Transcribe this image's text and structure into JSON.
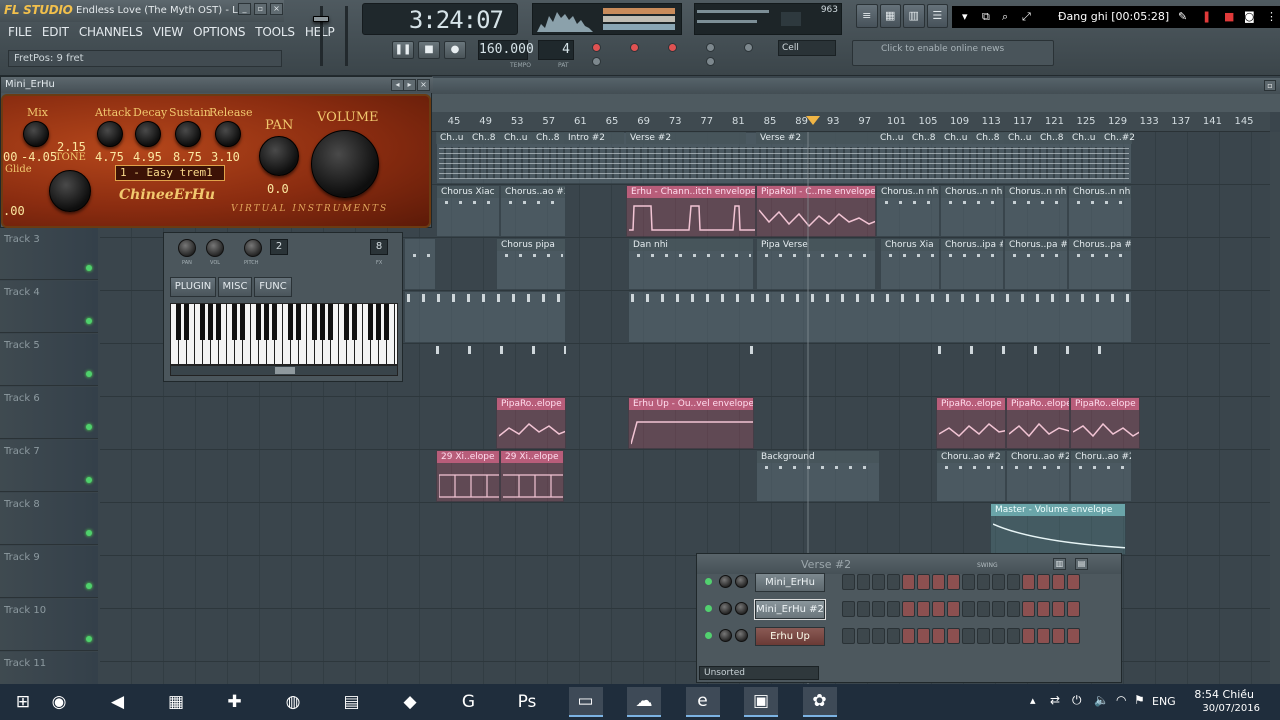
{
  "app": {
    "logo": "FL STUDIO",
    "song_title": "Endless Love (The Myth OST) - L",
    "menu": [
      "FILE",
      "EDIT",
      "CHANNELS",
      "VIEW",
      "OPTIONS",
      "TOOLS",
      "HELP"
    ],
    "hint": "FretPos: 9 fret",
    "time": "3:24:07",
    "tempo": "160.000",
    "pattern": "4",
    "tempo_label": "TEMPO",
    "pat_label": "PAT",
    "cpu_value": "963",
    "snap": "Cell",
    "news": "Click to enable online news"
  },
  "recorder": {
    "label": "Đang ghi [00:05:28]"
  },
  "playlist": {
    "title": "Mini_ErHu",
    "ticks": [
      "45",
      "49",
      "53",
      "57",
      "61",
      "65",
      "69",
      "73",
      "77",
      "81",
      "85",
      "89",
      "93",
      "97",
      "101",
      "105",
      "109",
      "113",
      "117",
      "121",
      "125",
      "129",
      "133",
      "137",
      "141",
      "145"
    ],
    "tracks": [
      "Track 3",
      "Track 4",
      "Track 5",
      "Track 6",
      "Track 7",
      "Track 8",
      "Track 9",
      "Track 10",
      "Track 11"
    ],
    "clips": {
      "t1": [
        "Ch..u",
        "Ch..8",
        "Ch..u",
        "Ch..8",
        "Intro #2",
        "Verse #2",
        "Verse #2",
        "Ch..u",
        "Ch..8",
        "Ch..u",
        "Ch..8",
        "Ch..u",
        "Ch..8",
        "Ch..u",
        "Ch..#2"
      ],
      "t2": [
        "Chorus Xiac",
        "Chorus..ao #3",
        "Erhu - Chann..itch envelope",
        "PipaRoll - C..me envelope",
        "Chorus..n nhi",
        "Chorus..n nhi",
        "Chorus..n nhi",
        "Chorus..n nhi"
      ],
      "t3": [
        "Chorus pipa",
        "Dan nhi",
        "Pipa Verse",
        "Chorus Xia",
        "Chorus..ipa #2",
        "Chorus..pa #2",
        "Chorus..pa #2"
      ],
      "t6": [
        "PipaRo..elope",
        "Erhu Up - Ou..vel envelope",
        "PipaRo..elope",
        "PipaRo..elope",
        "PipaRo..elope"
      ],
      "t7": [
        "29 Xi..elope",
        "29 Xi..elope",
        "Background",
        "Choru..ao #2",
        "Choru..ao #2",
        "Choru..ao #2"
      ],
      "t8": [
        "Master - Volume envelope"
      ]
    }
  },
  "plugin": {
    "labels": {
      "mix": "Mix",
      "attack": "Attack",
      "decay": "Decay",
      "sustain": "Sustain",
      "release": "Release",
      "pan": "PAN",
      "volume": "VOLUME",
      "tone": "TONE",
      "glide": "Glide"
    },
    "values": {
      "mix": "-4.05",
      "attack": "4.75",
      "decay": "4.95",
      "sustain": "8.75",
      "release": "3.10",
      "tone": "2.15",
      "pan": "0.0",
      "glide": ".00",
      "left": "00"
    },
    "preset": "1 - Easy trem1",
    "brand": "ChineeErHu",
    "sub": "VIRTUAL INSTRUMENTS"
  },
  "channel_panel": {
    "labels": [
      "PAN",
      "VOL",
      "PITCH"
    ],
    "range": "2",
    "fx": "8",
    "fx_label": "FX",
    "tabs": [
      "PLUGIN",
      "MISC",
      "FUNC"
    ]
  },
  "step_sequencer": {
    "pattern": "Verse #2",
    "swing": "SWING",
    "channels": [
      {
        "name": "Mini_ErHu",
        "selected": false,
        "red": false
      },
      {
        "name": "Mini_ErHu #2",
        "selected": true,
        "red": false
      },
      {
        "name": "Erhu Up",
        "selected": false,
        "red": true
      }
    ],
    "filter": "Unsorted"
  },
  "taskbar": {
    "icons": [
      "windows-start-icon",
      "chrome-icon",
      "audio-icon",
      "flash-icon",
      "paint-icon",
      "globe-icon",
      "calculator-icon",
      "camtasia-icon",
      "grammarly-icon",
      "photoshop-icon",
      "folder-icon",
      "cloud-icon",
      "edge-icon",
      "image-viewer-icon",
      "fl-studio-icon"
    ],
    "glyphs": [
      "⊞",
      "◉",
      "◀",
      "▦",
      "✚",
      "◍",
      "▤",
      "◆",
      "G",
      "Ps",
      "▭",
      "☁",
      "e",
      "▣",
      "✿"
    ],
    "lang": "ENG",
    "time": "8:54 Chiều",
    "date": "30/07/2016"
  },
  "colors": {
    "accent": "#f0b545",
    "envelope": "#b85d7a",
    "master_env": "#6aa5a9",
    "led": "#4fd16d",
    "recorder_red": "#e03a3a"
  }
}
